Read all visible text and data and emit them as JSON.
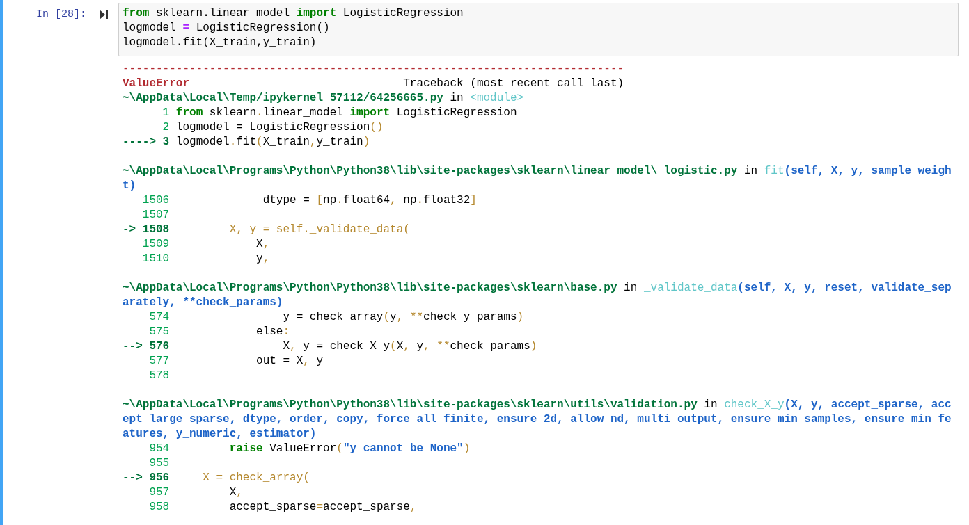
{
  "cell": {
    "prompt": "In [28]:",
    "selected": true,
    "code": [
      [
        {
          "kind": "keyword",
          "text": "from"
        },
        {
          "kind": "plain",
          "text": " sklearn.linear_model "
        },
        {
          "kind": "keyword",
          "text": "import"
        },
        {
          "kind": "plain",
          "text": " LogisticRegression"
        }
      ],
      [
        {
          "kind": "plain",
          "text": "logmodel "
        },
        {
          "kind": "operator",
          "text": "="
        },
        {
          "kind": "plain",
          "text": " LogisticRegression()"
        }
      ],
      [
        {
          "kind": "plain",
          "text": "logmodel.fit(X_train,y_train)"
        }
      ]
    ]
  },
  "traceback": {
    "rule": "---------------------------------------------------------------------------",
    "header": [
      {
        "kind": "error",
        "text": "ValueError"
      },
      {
        "kind": "plain",
        "text": "                                Traceback (most recent call last)"
      }
    ],
    "frames": [
      {
        "location": [
          {
            "kind": "path",
            "text": "~\\AppData\\Local\\Temp/ipykernel_57112/64256665.py"
          },
          {
            "kind": "plain",
            "text": " in "
          },
          {
            "kind": "function",
            "text": "<module>"
          }
        ],
        "lines": [
          {
            "prefix": "      1",
            "current": false,
            "segments": [
              {
                "kind": "keyword",
                "text": " from"
              },
              {
                "kind": "plain",
                "text": " sklearn"
              },
              {
                "kind": "accent",
                "text": "."
              },
              {
                "kind": "plain",
                "text": "linear_model "
              },
              {
                "kind": "keyword",
                "text": "import"
              },
              {
                "kind": "plain",
                "text": " LogisticRegression"
              }
            ]
          },
          {
            "prefix": "      2",
            "current": false,
            "segments": [
              {
                "kind": "plain",
                "text": " logmodel = LogisticRegression"
              },
              {
                "kind": "accent",
                "text": "()"
              }
            ]
          },
          {
            "prefix": "----> 3",
            "current": true,
            "segments": [
              {
                "kind": "plain",
                "text": " logmodel"
              },
              {
                "kind": "accent",
                "text": "."
              },
              {
                "kind": "plain",
                "text": "fit"
              },
              {
                "kind": "accent",
                "text": "("
              },
              {
                "kind": "plain",
                "text": "X_train"
              },
              {
                "kind": "accent",
                "text": ","
              },
              {
                "kind": "plain",
                "text": "y_train"
              },
              {
                "kind": "accent",
                "text": ")"
              }
            ]
          }
        ]
      },
      {
        "location": [
          {
            "kind": "path",
            "text": "~\\AppData\\Local\\Programs\\Python\\Python38\\lib\\site-packages\\sklearn\\linear_model\\_logistic.py"
          },
          {
            "kind": "plain",
            "text": " in "
          },
          {
            "kind": "function",
            "text": "fit"
          },
          {
            "kind": "args",
            "text": "(self, X, y, sample_weight)"
          }
        ],
        "lines": [
          {
            "prefix": "   1506",
            "current": false,
            "segments": [
              {
                "kind": "plain",
                "text": "             _dtype = "
              },
              {
                "kind": "accent",
                "text": "["
              },
              {
                "kind": "plain",
                "text": "np"
              },
              {
                "kind": "accent",
                "text": "."
              },
              {
                "kind": "plain",
                "text": "float64"
              },
              {
                "kind": "accent",
                "text": ", "
              },
              {
                "kind": "plain",
                "text": "np"
              },
              {
                "kind": "accent",
                "text": "."
              },
              {
                "kind": "plain",
                "text": "float32"
              },
              {
                "kind": "accent",
                "text": "]"
              }
            ]
          },
          {
            "prefix": "   1507",
            "current": false
          },
          {
            "prefix": "-> 1508",
            "current": true,
            "segments": [
              {
                "kind": "accent",
                "text": "         X, y = self._validate_data("
              }
            ]
          },
          {
            "prefix": "   1509",
            "current": false,
            "segments": [
              {
                "kind": "plain",
                "text": "             X"
              },
              {
                "kind": "accent",
                "text": ","
              }
            ]
          },
          {
            "prefix": "   1510",
            "current": false,
            "segments": [
              {
                "kind": "plain",
                "text": "             y"
              },
              {
                "kind": "accent",
                "text": ","
              }
            ]
          }
        ]
      },
      {
        "location": [
          {
            "kind": "path",
            "text": "~\\AppData\\Local\\Programs\\Python\\Python38\\lib\\site-packages\\sklearn\\base.py"
          },
          {
            "kind": "plain",
            "text": " in "
          },
          {
            "kind": "function",
            "text": "_validate_data"
          },
          {
            "kind": "args",
            "text": "(self, X, y, reset, validate_separately, **check_params)"
          }
        ],
        "lines": [
          {
            "prefix": "    574",
            "current": false,
            "segments": [
              {
                "kind": "plain",
                "text": "                 y = check_array"
              },
              {
                "kind": "accent",
                "text": "("
              },
              {
                "kind": "plain",
                "text": "y"
              },
              {
                "kind": "accent",
                "text": ", **"
              },
              {
                "kind": "plain",
                "text": "check_y_params"
              },
              {
                "kind": "accent",
                "text": ")"
              }
            ]
          },
          {
            "prefix": "    575",
            "current": false,
            "segments": [
              {
                "kind": "plain",
                "text": "             else"
              },
              {
                "kind": "accent",
                "text": ":"
              }
            ]
          },
          {
            "prefix": "--> 576",
            "current": true,
            "segments": [
              {
                "kind": "plain",
                "text": "                 X"
              },
              {
                "kind": "accent",
                "text": ", "
              },
              {
                "kind": "plain",
                "text": "y = check_X_y"
              },
              {
                "kind": "accent",
                "text": "("
              },
              {
                "kind": "plain",
                "text": "X"
              },
              {
                "kind": "accent",
                "text": ", "
              },
              {
                "kind": "plain",
                "text": "y"
              },
              {
                "kind": "accent",
                "text": ", **"
              },
              {
                "kind": "plain",
                "text": "check_params"
              },
              {
                "kind": "accent",
                "text": ")"
              }
            ]
          },
          {
            "prefix": "    577",
            "current": false,
            "segments": [
              {
                "kind": "plain",
                "text": "             out = X"
              },
              {
                "kind": "accent",
                "text": ", "
              },
              {
                "kind": "plain",
                "text": "y"
              }
            ]
          },
          {
            "prefix": "    578",
            "current": false
          }
        ]
      },
      {
        "location": [
          {
            "kind": "path",
            "text": "~\\AppData\\Local\\Programs\\Python\\Python38\\lib\\site-packages\\sklearn\\utils\\validation.py"
          },
          {
            "kind": "plain",
            "text": " in "
          },
          {
            "kind": "function",
            "text": "check_X_y"
          },
          {
            "kind": "args",
            "text": "(X, y, accept_sparse, accept_large_sparse, dtype, order, copy, force_all_finite, ensure_2d, allow_nd, multi_output, ensure_min_samples, ensure_min_features, y_numeric, estimator)"
          }
        ],
        "lines": [
          {
            "prefix": "    954",
            "current": false,
            "segments": [
              {
                "kind": "keyword",
                "text": "         raise"
              },
              {
                "kind": "plain",
                "text": " ValueError"
              },
              {
                "kind": "accent",
                "text": "("
              },
              {
                "kind": "string",
                "text": "\"y cannot be None\""
              },
              {
                "kind": "accent",
                "text": ")"
              }
            ]
          },
          {
            "prefix": "    955",
            "current": false
          },
          {
            "prefix": "--> 956",
            "current": true,
            "segments": [
              {
                "kind": "accent",
                "text": "     X = check_array("
              }
            ]
          },
          {
            "prefix": "    957",
            "current": false,
            "segments": [
              {
                "kind": "plain",
                "text": "         X"
              },
              {
                "kind": "accent",
                "text": ","
              }
            ]
          },
          {
            "prefix": "    958",
            "current": false,
            "segments": [
              {
                "kind": "plain",
                "text": "         accept_sparse"
              },
              {
                "kind": "accent",
                "text": "="
              },
              {
                "kind": "plain",
                "text": "accept_sparse"
              },
              {
                "kind": "accent",
                "text": ","
              }
            ]
          }
        ]
      }
    ]
  }
}
